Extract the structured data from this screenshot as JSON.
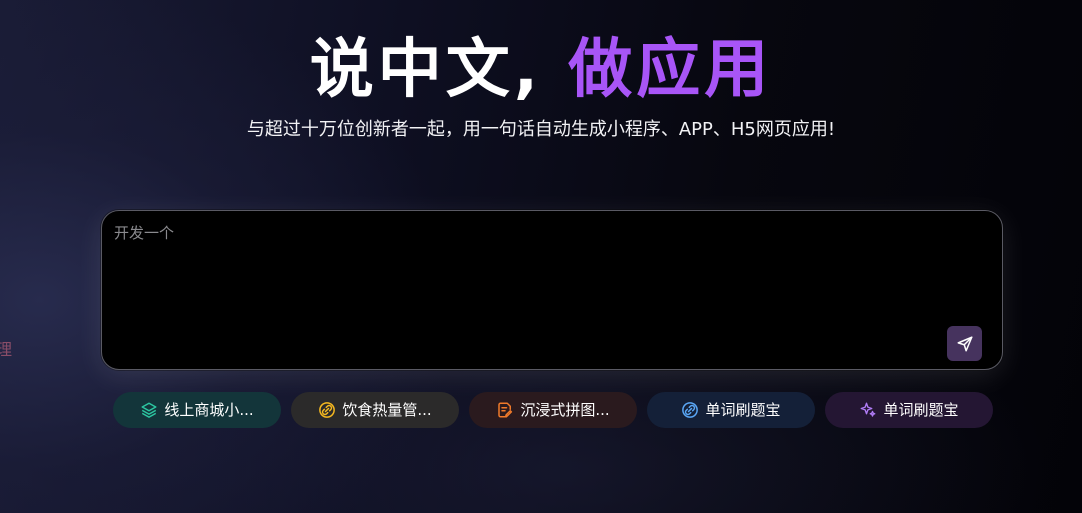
{
  "hero": {
    "title_white": "说中文,",
    "title_purple": "做应用",
    "subtitle": "与超过十万位创新者一起，用一句话自动生成小程序、APP、H5网页应用!"
  },
  "sidebar_fragment": {
    "text": "理"
  },
  "prompt": {
    "placeholder": "开发一个",
    "value": ""
  },
  "suggestions": [
    {
      "label": "线上商城小...",
      "icon": "layers-icon",
      "color": "#2cc5a0",
      "bg": "#13353a"
    },
    {
      "label": "饮食热量管...",
      "icon": "link-circle-icon",
      "color": "#f5b820",
      "bg": "#2b2a2a"
    },
    {
      "label": "沉浸式拼图...",
      "icon": "edit-doc-icon",
      "color": "#f07a2a",
      "bg": "#2a1a1e"
    },
    {
      "label": "单词刷题宝",
      "icon": "link-circle-icon",
      "color": "#5aa6f5",
      "bg": "#142038"
    },
    {
      "label": "单词刷题宝",
      "icon": "sparkles-icon",
      "color": "#b07cf5",
      "bg": "#241633"
    }
  ],
  "colors": {
    "accent_purple": "#a855f7",
    "send_button_bg": "#46335e"
  }
}
